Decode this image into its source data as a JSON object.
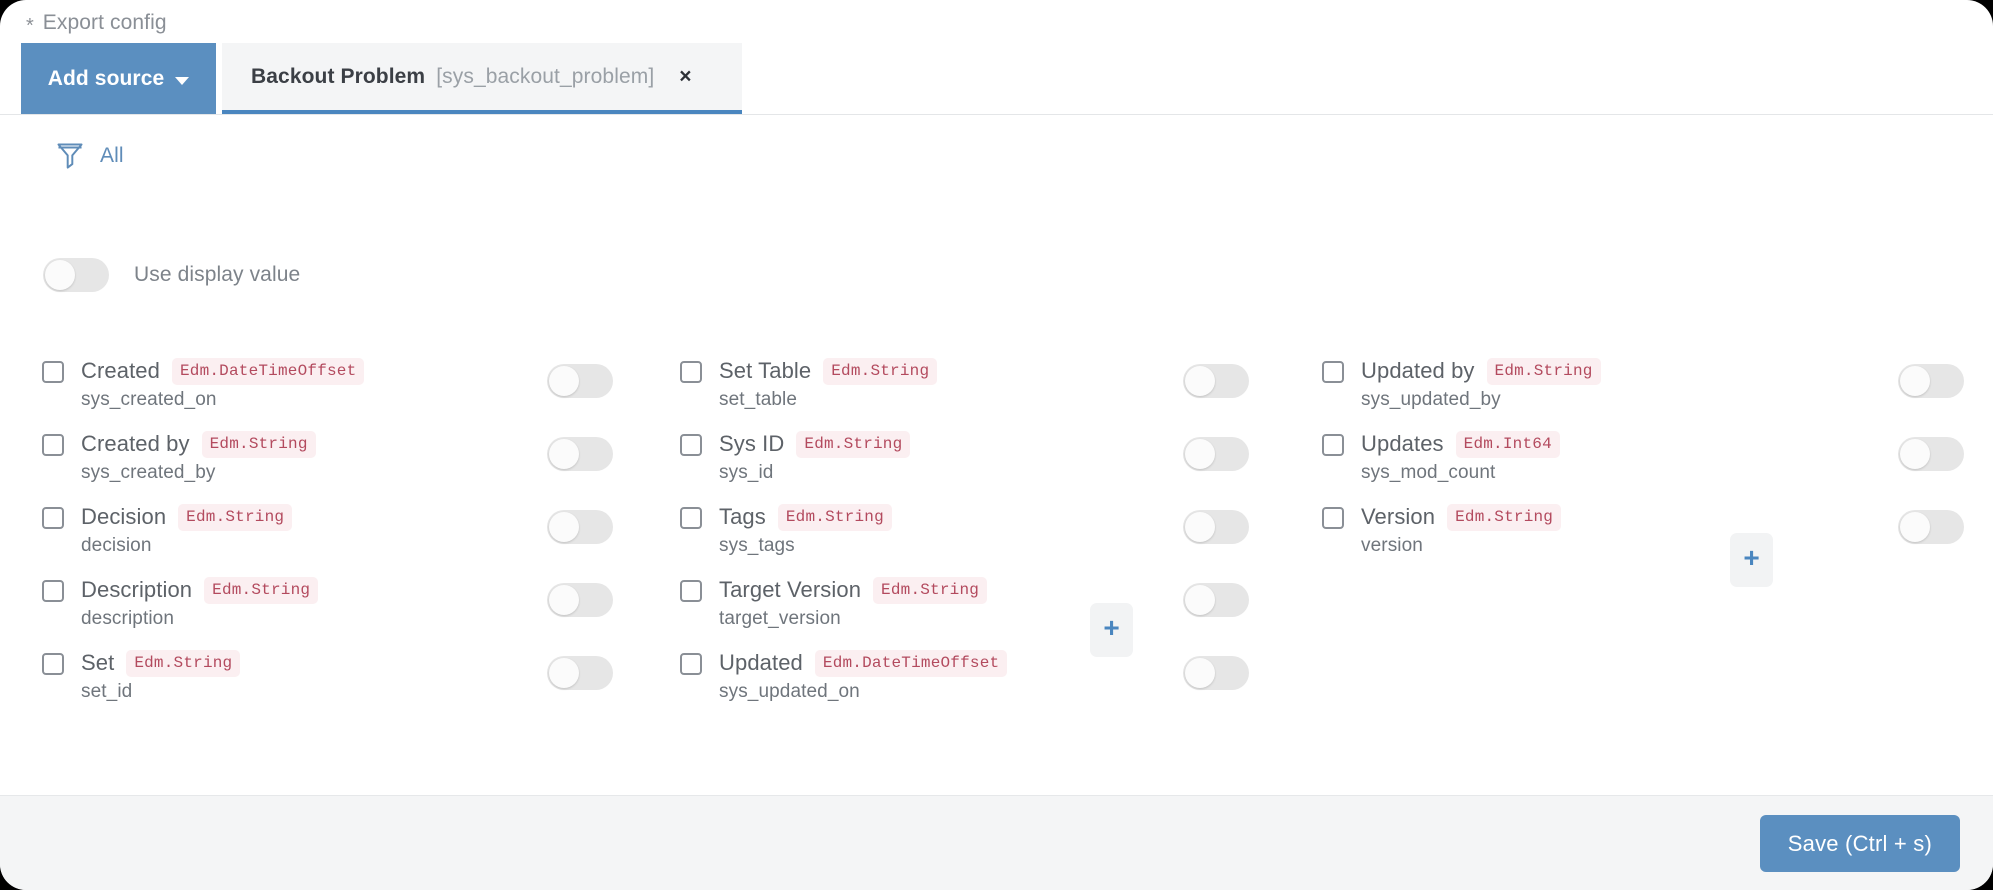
{
  "header": {
    "required_marker": "*",
    "title": "Export config"
  },
  "tabstrip": {
    "add_source_label": "Add source",
    "tab": {
      "label": "Backout Problem",
      "sublabel": "[sys_backout_problem]",
      "close_label": "×"
    }
  },
  "filter": {
    "icon": "funnel-icon",
    "label": "All"
  },
  "display_value": {
    "label": "Use display value",
    "enabled": false
  },
  "plus_buttons": {
    "glyph": "+"
  },
  "footer": {
    "save_label": "Save (Ctrl + s)"
  },
  "colors": {
    "accent": "#5b8fc0",
    "tab_underline": "#4a86bf",
    "badge_text": "#b34a5e",
    "badge_bg": "#fbeff1",
    "link": "#5f8cb8"
  },
  "columns": [
    {
      "fields": [
        {
          "title": "Created",
          "type": "Edm.DateTimeOffset",
          "name": "sys_created_on",
          "checked": false,
          "toggle": false
        },
        {
          "title": "Created by",
          "type": "Edm.String",
          "name": "sys_created_by",
          "checked": false,
          "toggle": false
        },
        {
          "title": "Decision",
          "type": "Edm.String",
          "name": "decision",
          "checked": false,
          "toggle": false
        },
        {
          "title": "Description",
          "type": "Edm.String",
          "name": "description",
          "checked": false,
          "toggle": false
        },
        {
          "title": "Set",
          "type": "Edm.String",
          "name": "set_id",
          "checked": false,
          "toggle": false
        }
      ]
    },
    {
      "fields": [
        {
          "title": "Set Table",
          "type": "Edm.String",
          "name": "set_table",
          "checked": false,
          "toggle": false
        },
        {
          "title": "Sys ID",
          "type": "Edm.String",
          "name": "sys_id",
          "checked": false,
          "toggle": false
        },
        {
          "title": "Tags",
          "type": "Edm.String",
          "name": "sys_tags",
          "checked": false,
          "toggle": false
        },
        {
          "title": "Target Version",
          "type": "Edm.String",
          "name": "target_version",
          "checked": false,
          "toggle": false
        },
        {
          "title": "Updated",
          "type": "Edm.DateTimeOffset",
          "name": "sys_updated_on",
          "checked": false,
          "toggle": false
        }
      ]
    },
    {
      "fields": [
        {
          "title": "Updated by",
          "type": "Edm.String",
          "name": "sys_updated_by",
          "checked": false,
          "toggle": false
        },
        {
          "title": "Updates",
          "type": "Edm.Int64",
          "name": "sys_mod_count",
          "checked": false,
          "toggle": false
        },
        {
          "title": "Version",
          "type": "Edm.String",
          "name": "version",
          "checked": false,
          "toggle": false
        }
      ]
    }
  ]
}
